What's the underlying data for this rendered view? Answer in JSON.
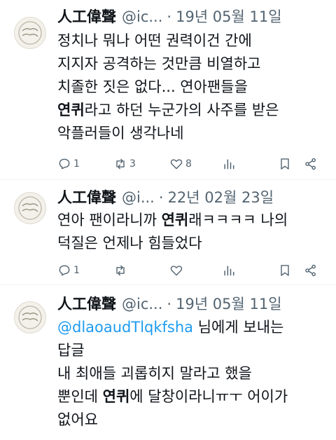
{
  "tweets": [
    {
      "name": "人工偉聲",
      "handle": "@ic...",
      "sep": "·",
      "date": "19년 05월 11일",
      "line1": "정치나 뭐나 어떤 권력이건 간에",
      "line2": "지지자 공격하는 것만큼 비열하고",
      "line3": "치졸한 짓은 없다... 연아팬들을",
      "line4_bold": "연퀴",
      "line4_rest": "라고 하던 누군가의 사주를 받은",
      "line5": "악플러들이 생각나네",
      "replies": "1",
      "retweets": "3",
      "likes": "8"
    },
    {
      "name": "人工偉聲",
      "handle": "@i...",
      "sep": "·",
      "date": "22년 02월 23일",
      "line1_pre": "연아 팬이라니까 ",
      "line1_bold": "연퀴",
      "line1_post": "래ㅋㅋㅋㅋ 나의",
      "line2": "덕질은 언제나 힘들었다",
      "replies": "1"
    },
    {
      "name": "人工偉聲",
      "handle": "@ic...",
      "sep": "·",
      "date": "19년 05월 11일",
      "mention": "@dlaoaudTlqkfsha",
      "mention_rest": " 님에게 보내는",
      "line2": "답글",
      "line3": "내 최애들 괴롭히지 말라고 했을",
      "line4_pre": "뿐인데 ",
      "line4_bold": "연퀴",
      "line4_post": "에 달창이라니ㅠㅜ 어이가",
      "line5": "없어요"
    }
  ],
  "icons": {
    "reply": "reply-icon",
    "retweet": "retweet-icon",
    "like": "heart-icon",
    "views": "views-icon",
    "bookmark": "bookmark-icon",
    "share": "share-icon"
  },
  "colors": {
    "text": "#0f1419",
    "secondary": "#536471",
    "link": "#1d9bf0"
  }
}
